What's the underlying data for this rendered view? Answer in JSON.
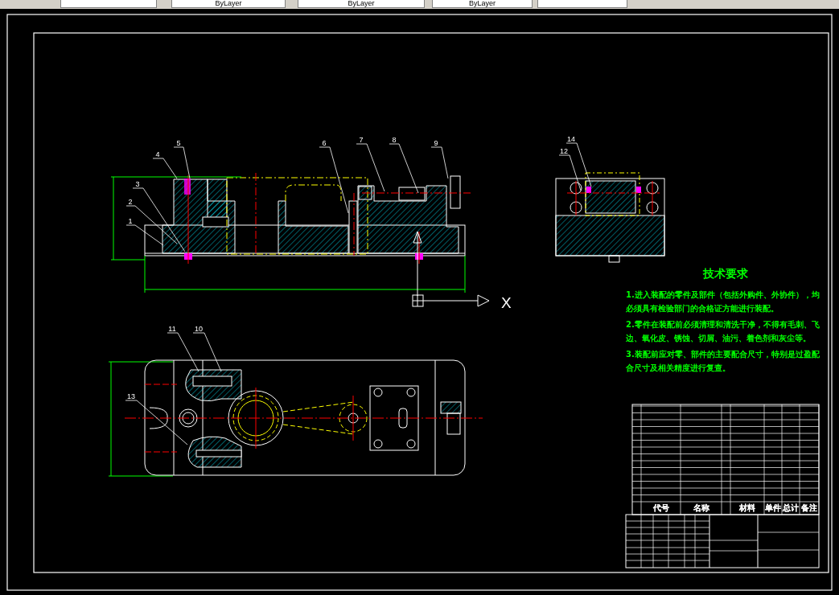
{
  "toolbar": {
    "dropdowns": [
      {
        "value": "ByLayer"
      },
      {
        "value": "ByLayer"
      },
      {
        "value": "ByLayer"
      }
    ]
  },
  "front_view": {
    "callouts": [
      {
        "number": "4"
      },
      {
        "number": "5"
      },
      {
        "number": "3"
      },
      {
        "number": "2"
      },
      {
        "number": "1"
      },
      {
        "number": "6"
      },
      {
        "number": "7"
      },
      {
        "number": "8"
      },
      {
        "number": "9"
      }
    ]
  },
  "ucs": {
    "axis_label": "X"
  },
  "side_view": {
    "callouts": [
      {
        "number": "14"
      },
      {
        "number": "12"
      }
    ]
  },
  "top_view": {
    "callouts": [
      {
        "number": "11"
      },
      {
        "number": "10"
      },
      {
        "number": "13"
      }
    ]
  },
  "technical_requirements": {
    "title": "技术要求",
    "items": [
      "1.进入装配的零件及部件（包括外购件、外协件），均必须具有检验部门的合格证方能进行装配。",
      "2.零件在装配前必须清理和清洗干净，不得有毛刺、飞边、氧化皮、锈蚀、切屑、油污、着色剂和灰尘等。",
      "3.装配前应对零、部件的主要配合尺寸，特别是过盈配合尺寸及相关精度进行复查。"
    ]
  },
  "parts_table": {
    "columns": [
      "代号",
      "名称",
      "材料",
      "单件",
      "总计",
      "备注"
    ]
  }
}
